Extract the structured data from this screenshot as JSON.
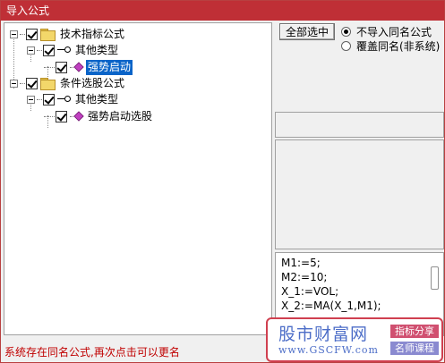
{
  "window": {
    "title": "导入公式"
  },
  "tree": {
    "nodes": [
      {
        "label": "技术指标公式",
        "level": 0,
        "type": "folder",
        "checked": true
      },
      {
        "label": "其他类型",
        "level": 1,
        "type": "key",
        "checked": true
      },
      {
        "label": "强势启动",
        "level": 2,
        "type": "formula",
        "checked": true,
        "selected": true
      },
      {
        "label": "条件选股公式",
        "level": 0,
        "type": "folder",
        "checked": true
      },
      {
        "label": "其他类型",
        "level": 1,
        "type": "key",
        "checked": true
      },
      {
        "label": "强势启动选股",
        "level": 2,
        "type": "formula",
        "checked": true,
        "selected": false
      }
    ]
  },
  "controls": {
    "select_all_label": "全部选中",
    "radio_options": [
      {
        "label": "不导入同名公式",
        "checked": true
      },
      {
        "label": "覆盖同名(非系统)",
        "checked": false
      }
    ]
  },
  "code": {
    "lines": [
      "M1:=5;",
      "M2:=10;",
      "X_1:=VOL;",
      "X_2:=MA(X_1,M1);"
    ]
  },
  "status": {
    "message": "系统存在同名公式,再次点击可以更名"
  },
  "watermark": {
    "title": "股市财富网",
    "url": "www.GSCFW.com",
    "tag1": "指标分享",
    "tag2": "名师课程"
  }
}
